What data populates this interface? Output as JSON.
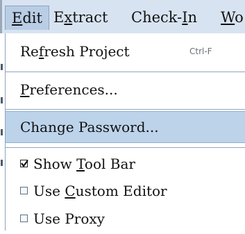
{
  "menubar": {
    "menus": [
      {
        "label": "Edit",
        "mnemonic": "E",
        "rest": "dit",
        "active": true
      },
      {
        "label": "Extract",
        "before": "E",
        "mnemonic": "x",
        "rest": "tract"
      },
      {
        "label": "Check-In",
        "before": "Check-",
        "mnemonic": "I",
        "rest": "n"
      },
      {
        "label": "Wo",
        "mnemonic": "W",
        "rest": "o"
      }
    ]
  },
  "edit_menu": {
    "items": [
      {
        "label": "Refresh Project",
        "before": "Re",
        "mnemonic": "f",
        "rest": "resh Project",
        "shortcut": "Ctrl-F"
      },
      {
        "label": "Preferences...",
        "before": "",
        "mnemonic": "P",
        "rest": "references..."
      },
      {
        "label": "Change Password...",
        "highlighted": true
      },
      {
        "label": "Show Tool Bar",
        "before": "Show ",
        "mnemonic": "T",
        "rest": "ool Bar",
        "checked": true
      },
      {
        "label": "Use Custom Editor",
        "before": "Use ",
        "mnemonic": "C",
        "rest": "ustom Editor",
        "checked": false
      },
      {
        "label": "Use Proxy",
        "checked": false
      }
    ]
  },
  "colors": {
    "menubar_bg": "#d7e3f0",
    "highlight_bg": "#bcd3ea",
    "border": "#8ea4c0"
  }
}
